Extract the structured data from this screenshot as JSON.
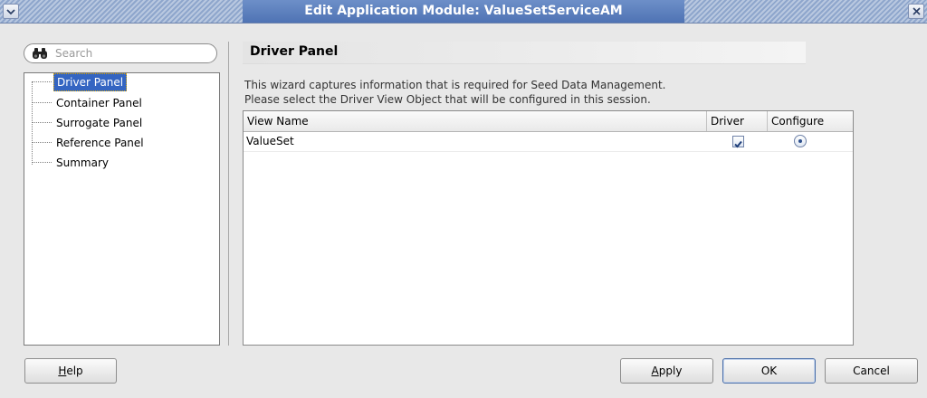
{
  "window": {
    "title": "Edit Application Module: ValueSetServiceAM",
    "menu_icon": "chevron-down-icon",
    "close_icon": "close-icon"
  },
  "search": {
    "placeholder": "Search",
    "icon": "binoculars-icon"
  },
  "nav": {
    "items": [
      {
        "label": "Driver Panel",
        "selected": true
      },
      {
        "label": "Container Panel",
        "selected": false
      },
      {
        "label": "Surrogate Panel",
        "selected": false
      },
      {
        "label": "Reference Panel",
        "selected": false
      },
      {
        "label": "Summary",
        "selected": false
      }
    ]
  },
  "panel": {
    "title": "Driver Panel",
    "description_line1": "This wizard captures information that is required for Seed Data Management.",
    "description_line2": "Please select the Driver View Object that will be configured in this session."
  },
  "table": {
    "columns": [
      "View Name",
      "Driver",
      "Configure"
    ],
    "rows": [
      {
        "view_name": "ValueSet",
        "driver": true,
        "configure": true
      }
    ]
  },
  "buttons": {
    "help": {
      "mnemonic": "H",
      "rest": "elp"
    },
    "apply": {
      "mnemonic": "A",
      "rest": "pply"
    },
    "ok": "OK",
    "cancel": "Cancel"
  },
  "colors": {
    "selection": "#3465c2",
    "titlebar": "#5a7dbd"
  }
}
